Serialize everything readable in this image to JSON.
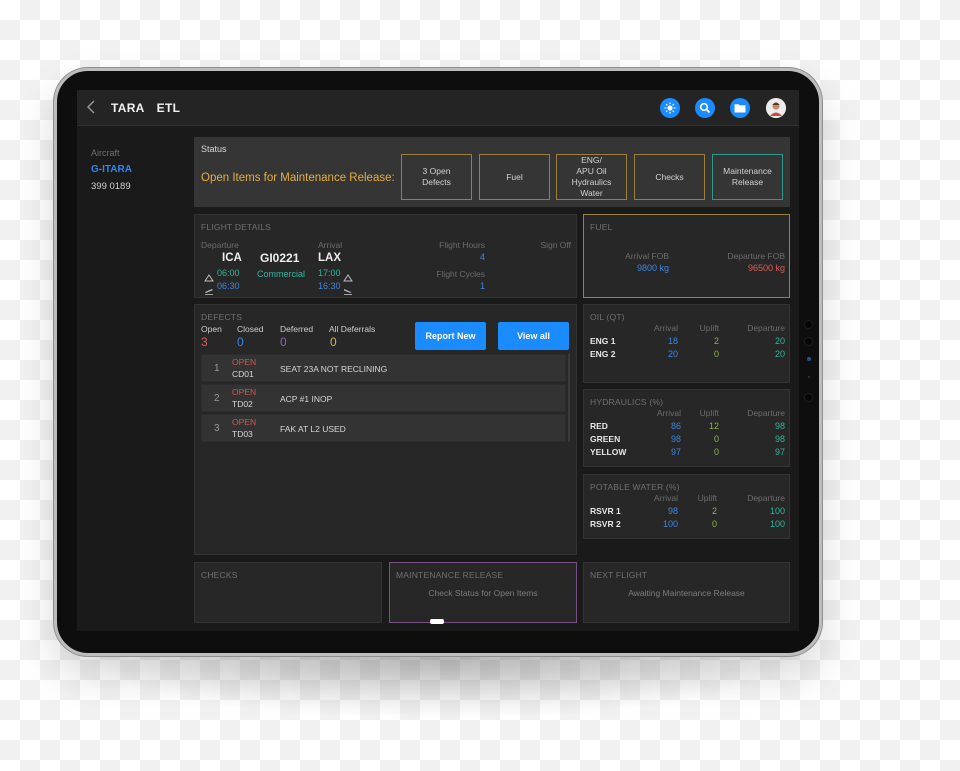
{
  "app": {
    "title_primary": "TARA",
    "title_secondary": "ETL",
    "back_icon": "chevron-left-icon",
    "toolbar_icons": [
      "brightness-icon",
      "search-icon",
      "folder-icon"
    ],
    "avatar": "user-avatar"
  },
  "sidebar": {
    "label": "Aircraft",
    "registration": "G-ITARA",
    "number": "399 0189"
  },
  "status": {
    "label": "Status",
    "message": "Open Items for Maintenance Release:",
    "items": [
      {
        "label": "3 Open Defects",
        "lines": [
          "3 Open",
          "Defects"
        ],
        "state": "open"
      },
      {
        "label": "Fuel",
        "lines": [
          "Fuel"
        ],
        "state": "open"
      },
      {
        "label": "ENG/ APU Oil Hydraulics Water",
        "lines": [
          "ENG/",
          "APU Oil",
          "Hydraulics",
          "Water"
        ],
        "state": "open"
      },
      {
        "label": "Checks",
        "lines": [
          "Checks"
        ],
        "state": "open"
      },
      {
        "label": "Maintenance Release",
        "lines": [
          "Maintenance",
          "Release"
        ],
        "state": "release"
      }
    ],
    "colors": {
      "open": "#9b7f3c",
      "release": "#2f9a8c"
    }
  },
  "flight": {
    "title": "FLIGHT DETAILS",
    "departure_label": "Departure",
    "arrival_label": "Arrival",
    "departure_code": "ICA",
    "flight_number": "GI0221",
    "arrival_code": "LAX",
    "flight_type": "Commercial",
    "dep_scheduled": "06:00",
    "dep_actual": "06:30",
    "arr_scheduled": "17:00",
    "arr_actual": "16:30",
    "flight_hours_label": "Flight Hours",
    "flight_hours": "4",
    "flight_cycles_label": "Flight Cycles",
    "flight_cycles": "1",
    "sign_off_label": "Sign Off"
  },
  "fuel": {
    "title": "FUEL",
    "arrival_label": "Arrival FOB",
    "arrival_value": "9800 kg",
    "departure_label": "Departure FOB",
    "departure_value": "96500 kg"
  },
  "defects": {
    "title": "DEFECTS",
    "counters": [
      {
        "label": "Open",
        "value": "3",
        "color": "#dc5b55"
      },
      {
        "label": "Closed",
        "value": "0",
        "color": "#3b86e0"
      },
      {
        "label": "Deferred",
        "value": "0",
        "color": "#8e63b5"
      },
      {
        "label": "All Deferrals",
        "value": "0",
        "color": "#e0b045"
      }
    ],
    "report_button": "Report New",
    "view_button": "View all",
    "rows": [
      {
        "index": "1",
        "status": "OPEN",
        "code": "CD01",
        "description": "SEAT 23A NOT RECLINING"
      },
      {
        "index": "2",
        "status": "OPEN",
        "code": "TD02",
        "description": "ACP #1 INOP"
      },
      {
        "index": "3",
        "status": "OPEN",
        "code": "TD03",
        "description": "FAK AT L2 USED"
      }
    ]
  },
  "oil": {
    "title": "OIL (QT)",
    "headers": [
      "Arrival",
      "Uplift",
      "Departure"
    ],
    "rows": [
      {
        "name": "ENG 1",
        "arrival": "18",
        "uplift": "2",
        "departure": "20"
      },
      {
        "name": "ENG 2",
        "arrival": "20",
        "uplift": "0",
        "departure": "20"
      }
    ]
  },
  "hydraulics": {
    "title": "HYDRAULICS (%)",
    "headers": [
      "Arrival",
      "Uplift",
      "Departure"
    ],
    "rows": [
      {
        "name": "RED",
        "arrival": "86",
        "uplift": "12",
        "departure": "98"
      },
      {
        "name": "GREEN",
        "arrival": "98",
        "uplift": "0",
        "departure": "98"
      },
      {
        "name": "YELLOW",
        "arrival": "97",
        "uplift": "0",
        "departure": "97"
      }
    ]
  },
  "water": {
    "title": "POTABLE WATER (%)",
    "headers": [
      "Arrival",
      "Uplift",
      "Departure"
    ],
    "rows": [
      {
        "name": "RSVR 1",
        "arrival": "98",
        "uplift": "2",
        "departure": "100"
      },
      {
        "name": "RSVR 2",
        "arrival": "100",
        "uplift": "0",
        "departure": "100"
      }
    ]
  },
  "checks": {
    "title": "CHECKS"
  },
  "maintenance_release": {
    "title": "MAINTENANCE RELEASE",
    "message": "Check Status for Open Items"
  },
  "next_flight": {
    "title": "NEXT FLIGHT",
    "message": "Awaiting Maintenance Release"
  }
}
